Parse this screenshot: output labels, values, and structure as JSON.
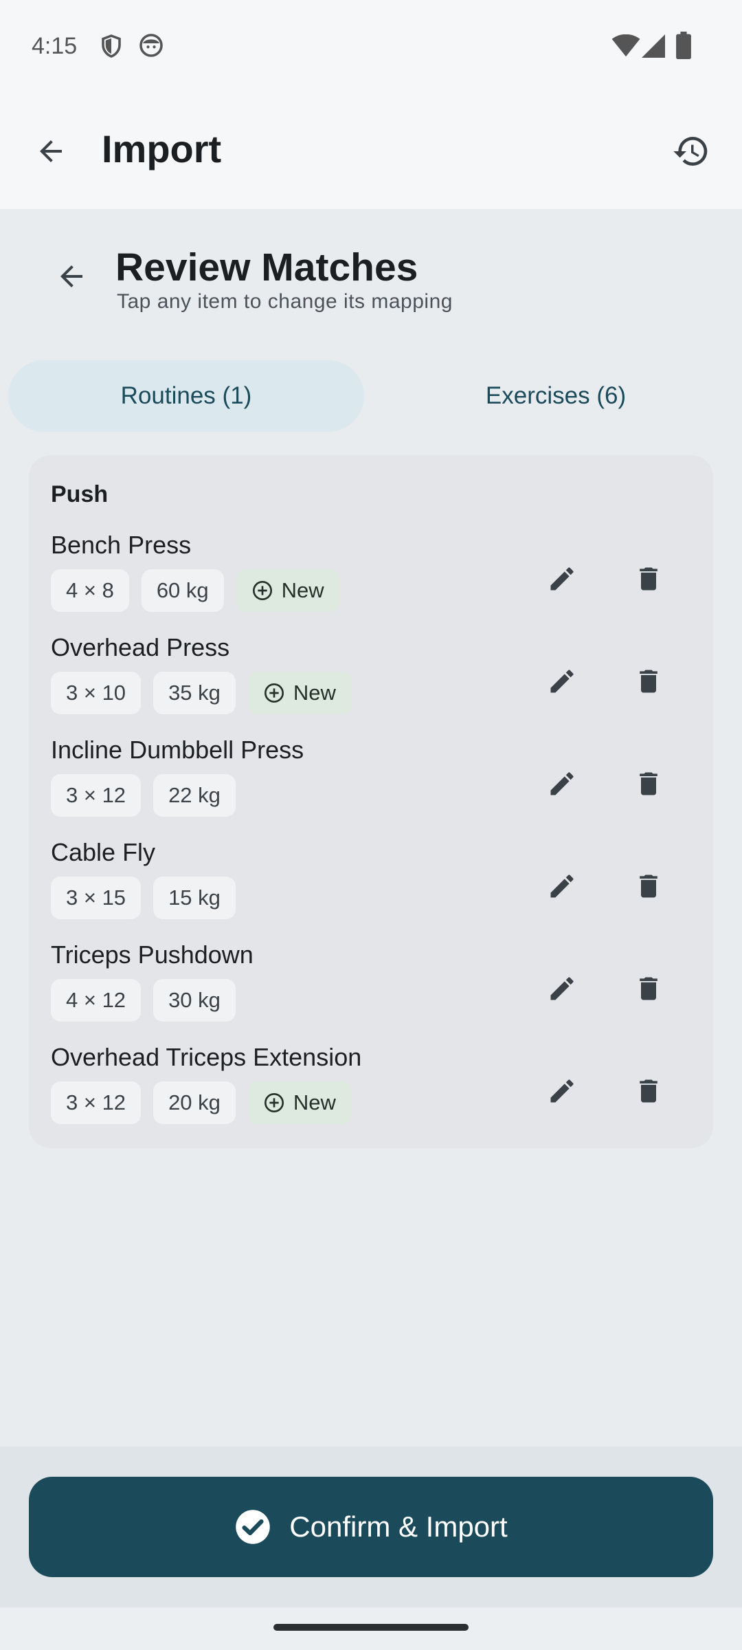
{
  "status": {
    "time": "4:15",
    "left_icons": [
      "shield-icon",
      "face-icon"
    ],
    "right_icons": [
      "wifi-icon",
      "signal-icon",
      "battery-icon"
    ]
  },
  "appbar": {
    "title": "Import",
    "back_icon": "arrow-back-icon",
    "history_icon": "history-icon"
  },
  "review": {
    "title": "Review Matches",
    "subtitle": "Tap any item to change its mapping"
  },
  "tabs": [
    {
      "label": "Routines (1)",
      "active": true
    },
    {
      "label": "Exercises (6)",
      "active": false
    }
  ],
  "routine": {
    "name": "Push",
    "exercises": [
      {
        "name": "Bench Press",
        "sets": "4 × 8",
        "weight": "60 kg",
        "badge": "New"
      },
      {
        "name": "Overhead Press",
        "sets": "3 × 10",
        "weight": "35 kg",
        "badge": "New"
      },
      {
        "name": "Incline Dumbbell Press",
        "sets": "3 × 12",
        "weight": "22 kg",
        "badge": ""
      },
      {
        "name": "Cable Fly",
        "sets": "3 × 15",
        "weight": "15 kg",
        "badge": ""
      },
      {
        "name": "Triceps Pushdown",
        "sets": "4 × 12",
        "weight": "30 kg",
        "badge": ""
      },
      {
        "name": "Overhead Triceps Extension",
        "sets": "3 × 12",
        "weight": "20 kg",
        "badge": "New"
      }
    ]
  },
  "actions": {
    "edit_icon": "pencil-icon",
    "delete_icon": "trash-icon"
  },
  "confirm": {
    "label": "Confirm & Import",
    "icon": "check-circle-icon"
  },
  "colors": {
    "primary": "#1b4b5b",
    "tab_active_bg": "#dbe8ee",
    "new_badge_bg": "#deeadf",
    "card_bg": "#e3e5e8"
  }
}
